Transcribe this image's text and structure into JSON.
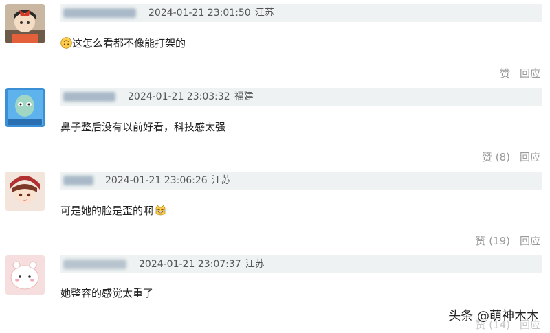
{
  "comments": [
    {
      "timestamp": "2024-01-21 23:01:50",
      "location": "江苏",
      "text": "这怎么看都不像能打架的",
      "like_label": "赞",
      "like_count": "",
      "reply_label": "回应",
      "emoji": "upside-down-face-icon"
    },
    {
      "timestamp": "2024-01-21 23:03:32",
      "location": "福建",
      "text": "鼻子整后没有以前好看，科技感太强",
      "like_label": "赞 (8)",
      "like_count": "8",
      "reply_label": "回应"
    },
    {
      "timestamp": "2024-01-21 23:06:26",
      "location": "江苏",
      "text": "可是她的脸是歪的啊",
      "like_label": "赞 (19)",
      "like_count": "19",
      "reply_label": "回应",
      "emoji": "cat-laughing-icon"
    },
    {
      "timestamp": "2024-01-21 23:07:37",
      "location": "江苏",
      "text": "她整容的感觉太重了",
      "like_label": "赞 (14)",
      "like_count": "14",
      "reply_label": "回应"
    }
  ],
  "watermark": "头条 @萌神木木",
  "colors": {
    "header_bg": "#eef2f2",
    "action_gray": "#999999",
    "meta_gray": "#555555"
  }
}
